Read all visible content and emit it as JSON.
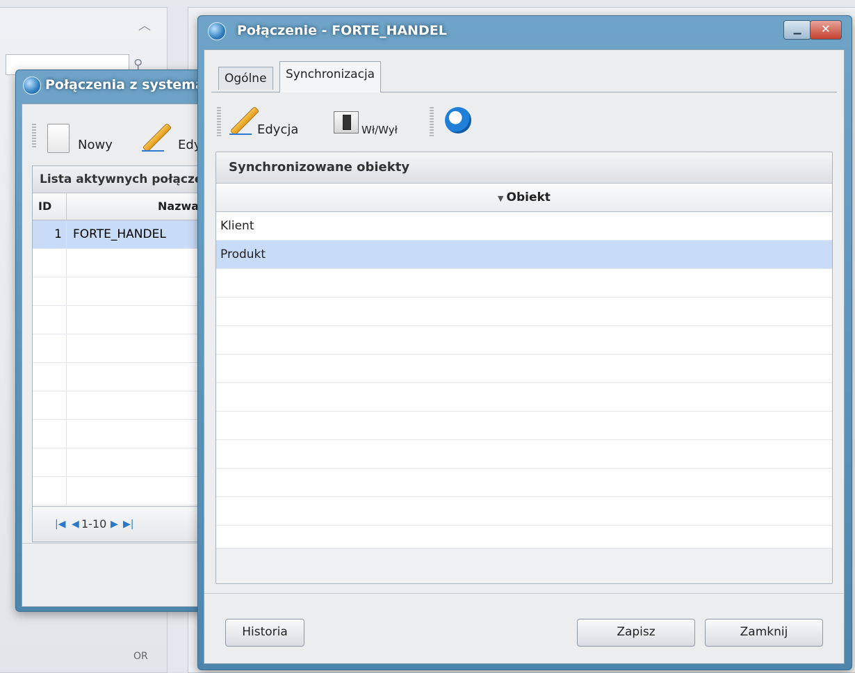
{
  "background": {
    "or_label": "OR"
  },
  "left_dialog": {
    "title": "Połączenia z systemami zewnętrznymi",
    "toolbar": {
      "new_label": "Nowy",
      "edit_label": "Edycja"
    },
    "list": {
      "header": "Lista aktywnych połączeń",
      "columns": {
        "id": "ID",
        "name": "Nazwa"
      },
      "rows": [
        {
          "id": "1",
          "name": "FORTE_HANDEL"
        }
      ],
      "pager_text": "1-10"
    }
  },
  "main_dialog": {
    "title": "Połączenie - FORTE_HANDEL",
    "tabs": [
      {
        "label": "Ogólne",
        "active": false
      },
      {
        "label": "Synchronizacja",
        "active": true
      }
    ],
    "toolbar": {
      "edit_label": "Edycja",
      "toggle_label": "Wł/Wył"
    },
    "objects": {
      "header": "Synchronizowane obiekty",
      "column": "Obiekt",
      "rows": [
        {
          "name": "Klient",
          "selected": false
        },
        {
          "name": "Produkt",
          "selected": true
        }
      ]
    },
    "buttons": {
      "history": "Historia",
      "save": "Zapisz",
      "close": "Zamknij"
    }
  },
  "colors": {
    "title_bar": "#4d86ad",
    "selection": "#c9dcf7"
  }
}
